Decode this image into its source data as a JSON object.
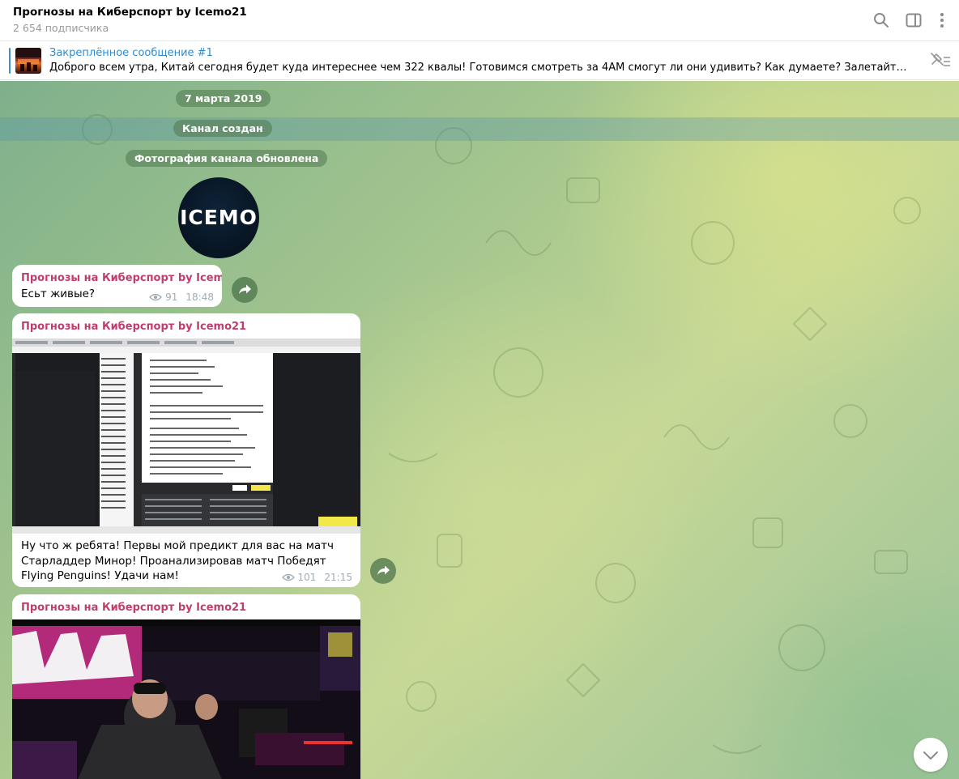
{
  "header": {
    "title": "Прогнозы на Киберспорт by Icemo21",
    "subscribers": "2 654 подписчика",
    "icons": [
      "search-icon",
      "sidebar-toggle-icon",
      "more-vertical-icon"
    ]
  },
  "pinned": {
    "title": "Закреплённое сообщение #1",
    "text": "Доброго всем утра, Китай сегодня будет куда интереснее чем 322 квалы! Готовимся смотреть за 4AM смогут ли они удивить? Как думаете? Залетайте и делитесь вашим…",
    "icon": "unpin-icon"
  },
  "service": {
    "date": "7 марта 2019",
    "created": "Канал создан",
    "photo_updated": "Фотография канала обновлена",
    "avatar_text": "ICEMO"
  },
  "messages": [
    {
      "author": "Прогнозы на Киберспорт by Icemo21",
      "text": "Есьт живые?",
      "views": "91",
      "time": "18:48"
    },
    {
      "author": "Прогнозы на Киберспорт by Icemo21",
      "text": "Ну что ж ребята! Первы мой предикт для вас на матч Старладдер Минор! Проанализировав матч Победят Flying Penguins! Удачи нам!",
      "views": "101",
      "time": "21:15"
    },
    {
      "author": "Прогнозы на Киберспорт by Icemo21"
    }
  ],
  "colors": {
    "author": "#c03d6e",
    "link": "#2e8bd1",
    "meta": "#a0acb6"
  }
}
